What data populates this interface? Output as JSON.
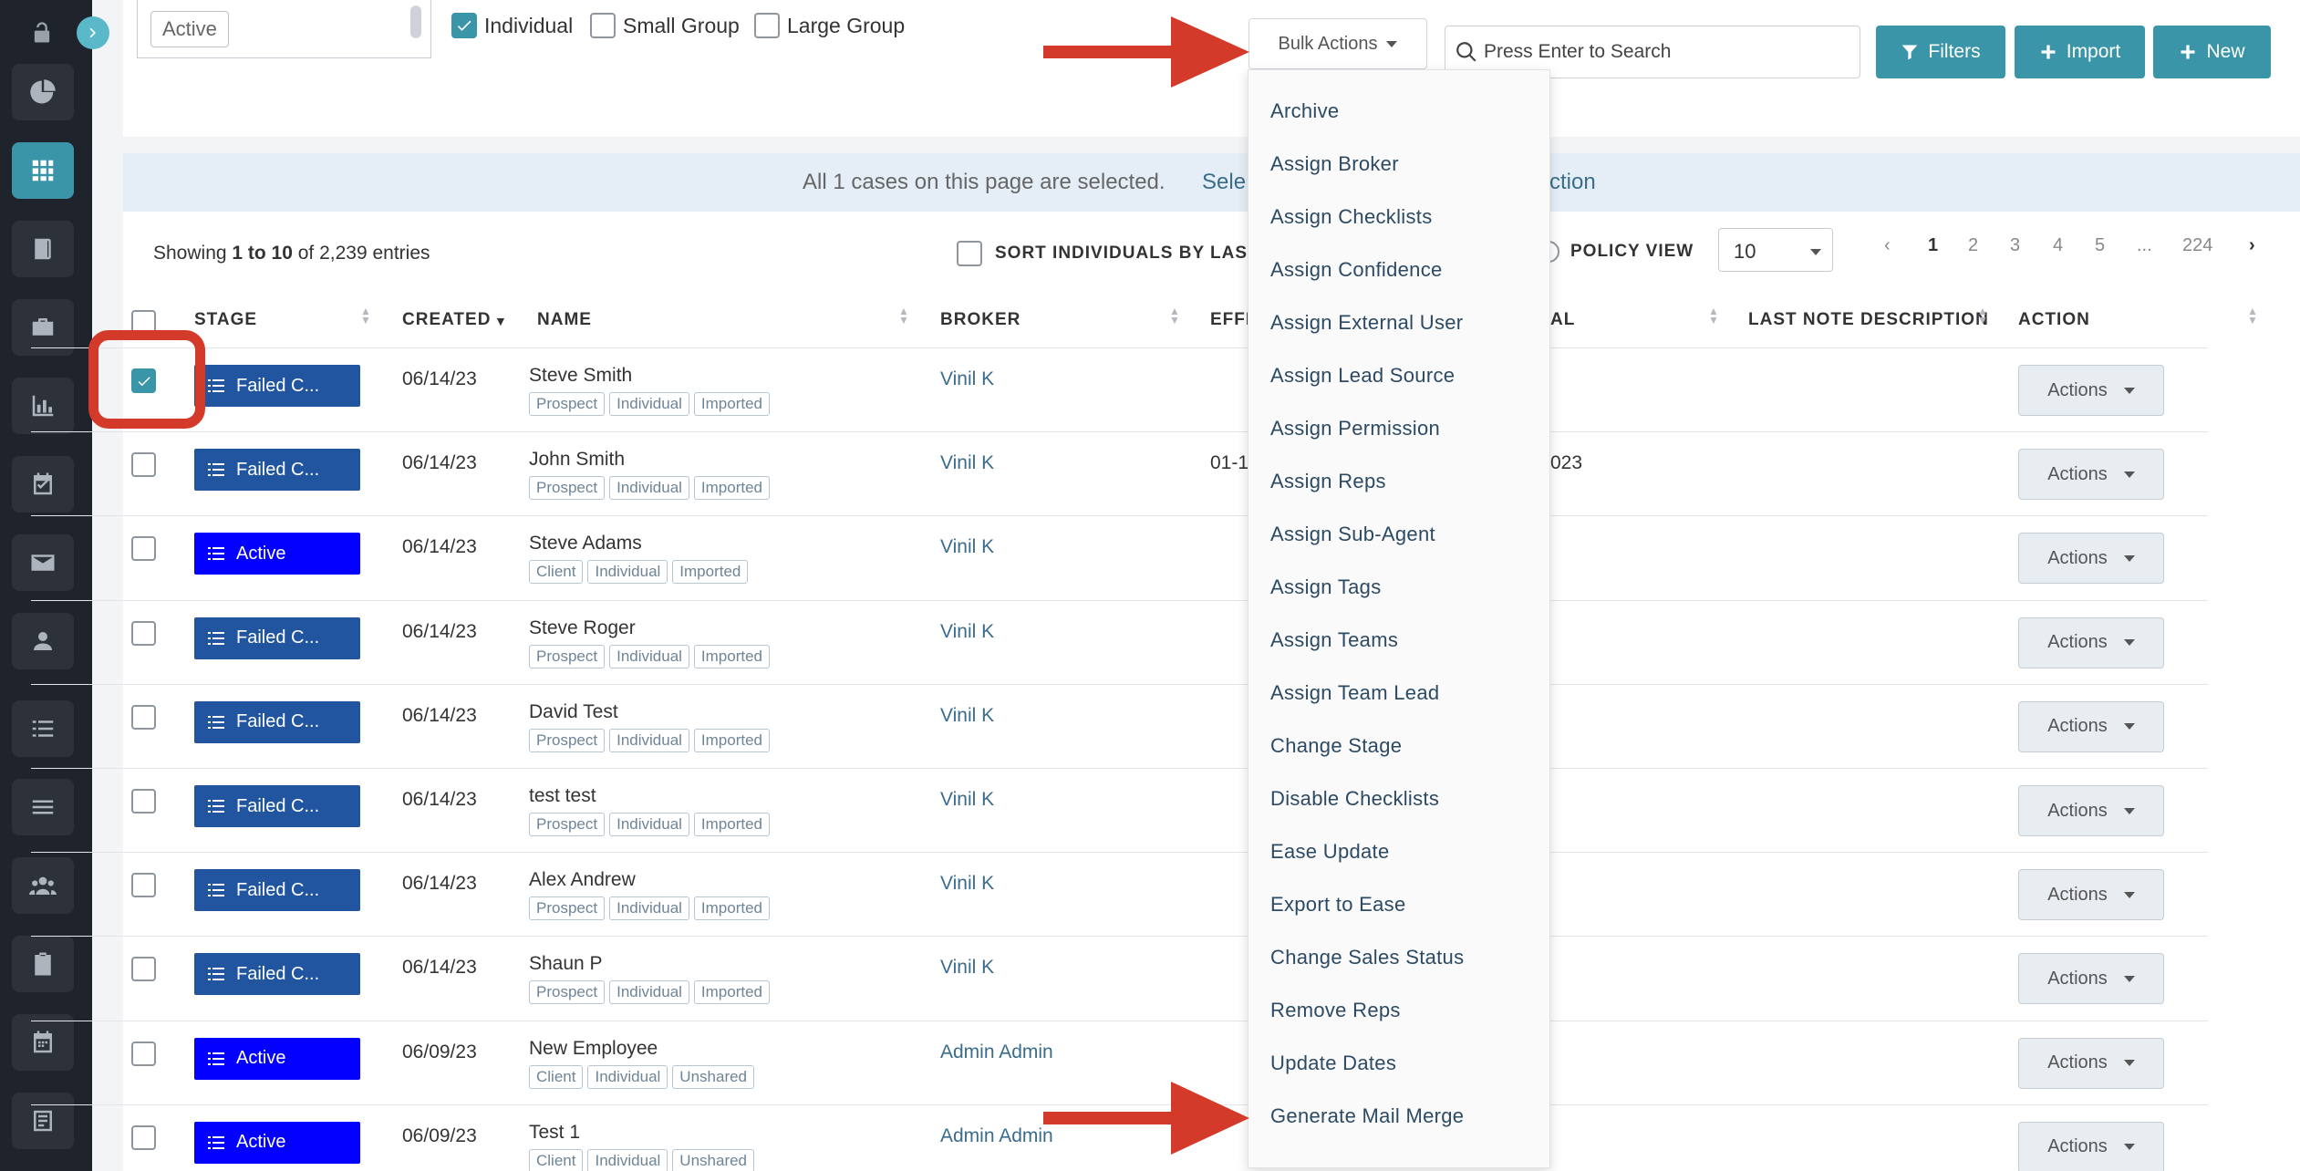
{
  "stage_filter": {
    "chip": "Active"
  },
  "type_filters": [
    {
      "label": "Individual",
      "checked": true
    },
    {
      "label": "Small Group",
      "checked": false
    },
    {
      "label": "Large Group",
      "checked": false
    }
  ],
  "toolbar": {
    "bulk_actions": "Bulk Actions",
    "search_placeholder": "Press Enter to Search",
    "filters": "Filters",
    "import": "Import",
    "new": "New"
  },
  "banner": {
    "text": "All 1 cases on this page are selected.",
    "link_start": "Sele",
    "link_end": "ction"
  },
  "table_meta": {
    "showing_prefix": "Showing ",
    "showing_range": "1 to 10",
    "showing_suffix": " of 2,239 entries",
    "sort_individuals": "SORT INDIVIDUALS BY LAST",
    "policy_view": "POLICY VIEW",
    "page_size": "10"
  },
  "pagination": [
    "‹",
    "1",
    "2",
    "3",
    "4",
    "5",
    "...",
    "224",
    "›"
  ],
  "columns": {
    "stage": "STAGE",
    "created": "CREATED",
    "name": "NAME",
    "broker": "BROKER",
    "effective": "EFFE",
    "renewal": "AL",
    "last_note": "LAST NOTE DESCRIPTION",
    "action": "ACTION"
  },
  "rows": [
    {
      "checked": true,
      "stage": "Failed C...",
      "stage_type": "failed",
      "created": "06/14/23",
      "name": "Steve Smith",
      "tags": [
        "Prospect",
        "Individual",
        "Imported"
      ],
      "broker": "Vinil K",
      "effective": "",
      "renewal": "",
      "action": "Actions"
    },
    {
      "checked": false,
      "stage": "Failed C...",
      "stage_type": "failed",
      "created": "06/14/23",
      "name": "John Smith",
      "tags": [
        "Prospect",
        "Individual",
        "Imported"
      ],
      "broker": "Vinil K",
      "effective": "01-1",
      "renewal": "023",
      "action": "Actions"
    },
    {
      "checked": false,
      "stage": "Active",
      "stage_type": "active",
      "created": "06/14/23",
      "name": "Steve Adams",
      "tags": [
        "Client",
        "Individual",
        "Imported"
      ],
      "broker": "Vinil K",
      "effective": "",
      "renewal": "",
      "action": "Actions"
    },
    {
      "checked": false,
      "stage": "Failed C...",
      "stage_type": "failed",
      "created": "06/14/23",
      "name": "Steve Roger",
      "tags": [
        "Prospect",
        "Individual",
        "Imported"
      ],
      "broker": "Vinil K",
      "effective": "",
      "renewal": "",
      "action": "Actions"
    },
    {
      "checked": false,
      "stage": "Failed C...",
      "stage_type": "failed",
      "created": "06/14/23",
      "name": "David Test",
      "tags": [
        "Prospect",
        "Individual",
        "Imported"
      ],
      "broker": "Vinil K",
      "effective": "",
      "renewal": "",
      "action": "Actions"
    },
    {
      "checked": false,
      "stage": "Failed C...",
      "stage_type": "failed",
      "created": "06/14/23",
      "name": "test test",
      "tags": [
        "Prospect",
        "Individual",
        "Imported"
      ],
      "broker": "Vinil K",
      "effective": "",
      "renewal": "",
      "action": "Actions"
    },
    {
      "checked": false,
      "stage": "Failed C...",
      "stage_type": "failed",
      "created": "06/14/23",
      "name": "Alex Andrew",
      "tags": [
        "Prospect",
        "Individual",
        "Imported"
      ],
      "broker": "Vinil K",
      "effective": "",
      "renewal": "",
      "action": "Actions"
    },
    {
      "checked": false,
      "stage": "Failed C...",
      "stage_type": "failed",
      "created": "06/14/23",
      "name": "Shaun P",
      "tags": [
        "Prospect",
        "Individual",
        "Imported"
      ],
      "broker": "Vinil K",
      "effective": "",
      "renewal": "",
      "action": "Actions"
    },
    {
      "checked": false,
      "stage": "Active",
      "stage_type": "active",
      "created": "06/09/23",
      "name": "New Employee",
      "tags": [
        "Client",
        "Individual",
        "Unshared"
      ],
      "broker": "Admin Admin",
      "effective": "",
      "renewal": "",
      "action": "Actions"
    },
    {
      "checked": false,
      "stage": "Active",
      "stage_type": "active",
      "created": "06/09/23",
      "name": "Test 1",
      "tags": [
        "Client",
        "Individual",
        "Unshared"
      ],
      "broker": "Admin Admin",
      "effective": "",
      "renewal": "",
      "action": "Actions"
    }
  ],
  "bulk_menu": [
    "Archive",
    "Assign Broker",
    "Assign Checklists",
    "Assign Confidence",
    "Assign External User",
    "Assign Lead Source",
    "Assign Permission",
    "Assign Reps",
    "Assign Sub-Agent",
    "Assign Tags",
    "Assign Teams",
    "Assign Team Lead",
    "Change Stage",
    "Disable Checklists",
    "Ease Update",
    "Export to Ease",
    "Change Sales Status",
    "Remove Reps",
    "Update Dates",
    "Generate Mail Merge"
  ],
  "sidebar_icons": [
    "dashboard-pie-icon",
    "cases-grid-icon",
    "book-icon",
    "briefcase-icon",
    "bar-chart-icon",
    "calendar-check-icon",
    "mail-icon",
    "user-icon",
    "list-icon",
    "menu-lines-icon",
    "users-icon",
    "clipboard-icon",
    "calendar-icon",
    "document-icon"
  ],
  "colors": {
    "accent": "#3b95a8",
    "failed_stage": "#2255a0",
    "active_stage": "#0400ff",
    "annotation": "#d33a2a",
    "sidebar": "#1f232b"
  }
}
